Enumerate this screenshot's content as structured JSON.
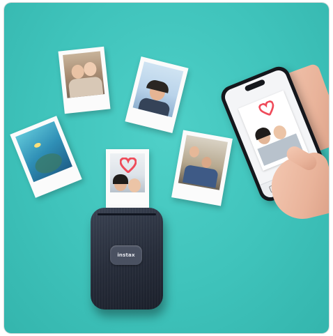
{
  "scene": {
    "description_colors": {
      "background": "#3fc3bb",
      "printer_body": "#262c39",
      "photo_border": "#fbfbfb",
      "heart": "#ef4b5a"
    },
    "printer": {
      "logo_text": "instax"
    },
    "phone": {
      "app_title": ""
    }
  }
}
